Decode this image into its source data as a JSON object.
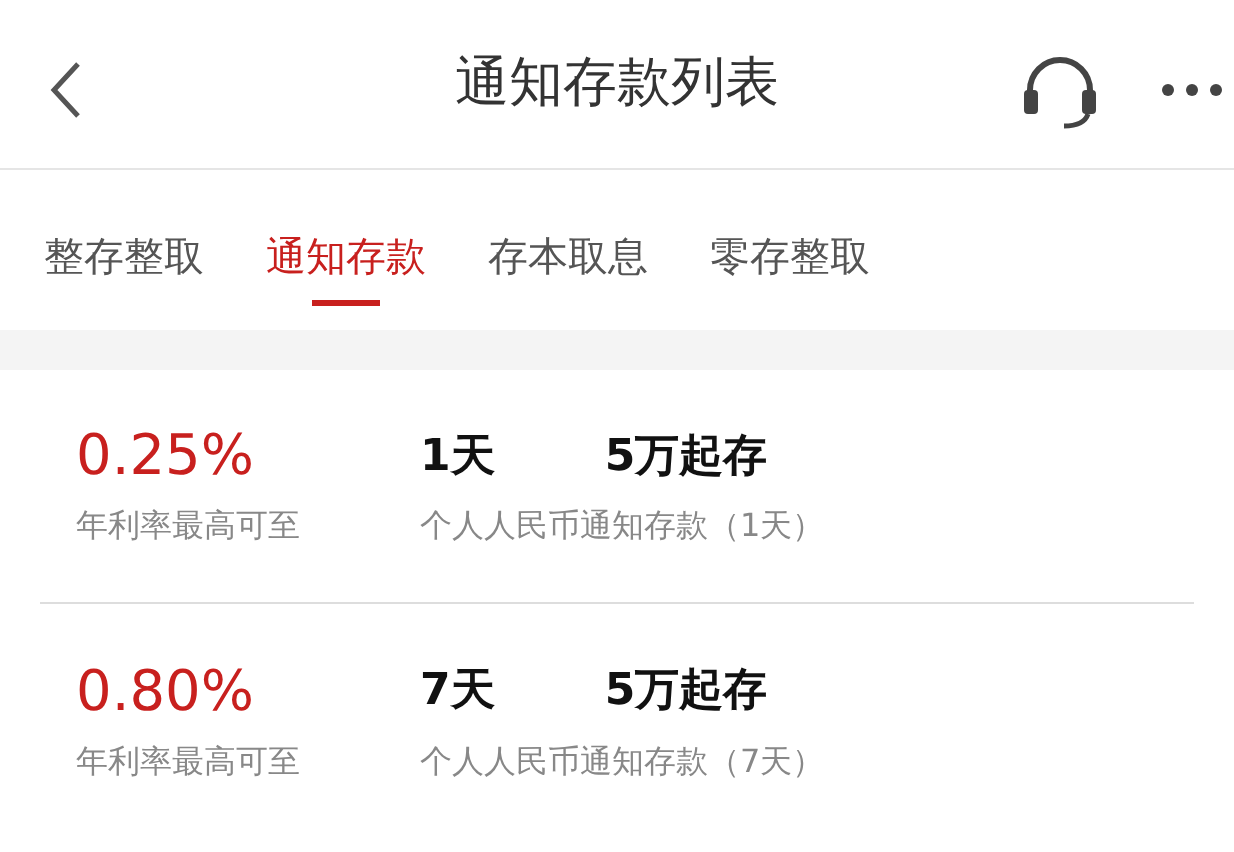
{
  "header": {
    "title": "通知存款列表"
  },
  "tabs": [
    {
      "label": "整存整取",
      "selected": false
    },
    {
      "label": "通知存款",
      "selected": true
    },
    {
      "label": "存本取息",
      "selected": false
    },
    {
      "label": "零存整取",
      "selected": false
    }
  ],
  "products": [
    {
      "rate": "0.25%",
      "rate_label": "年利率最高可至",
      "term": "1天",
      "minimum": "5万起存",
      "name": "个人人民币通知存款（1天）"
    },
    {
      "rate": "0.80%",
      "rate_label": "年利率最高可至",
      "term": "7天",
      "minimum": "5万起存",
      "name": "个人人民币通知存款（7天）"
    }
  ]
}
